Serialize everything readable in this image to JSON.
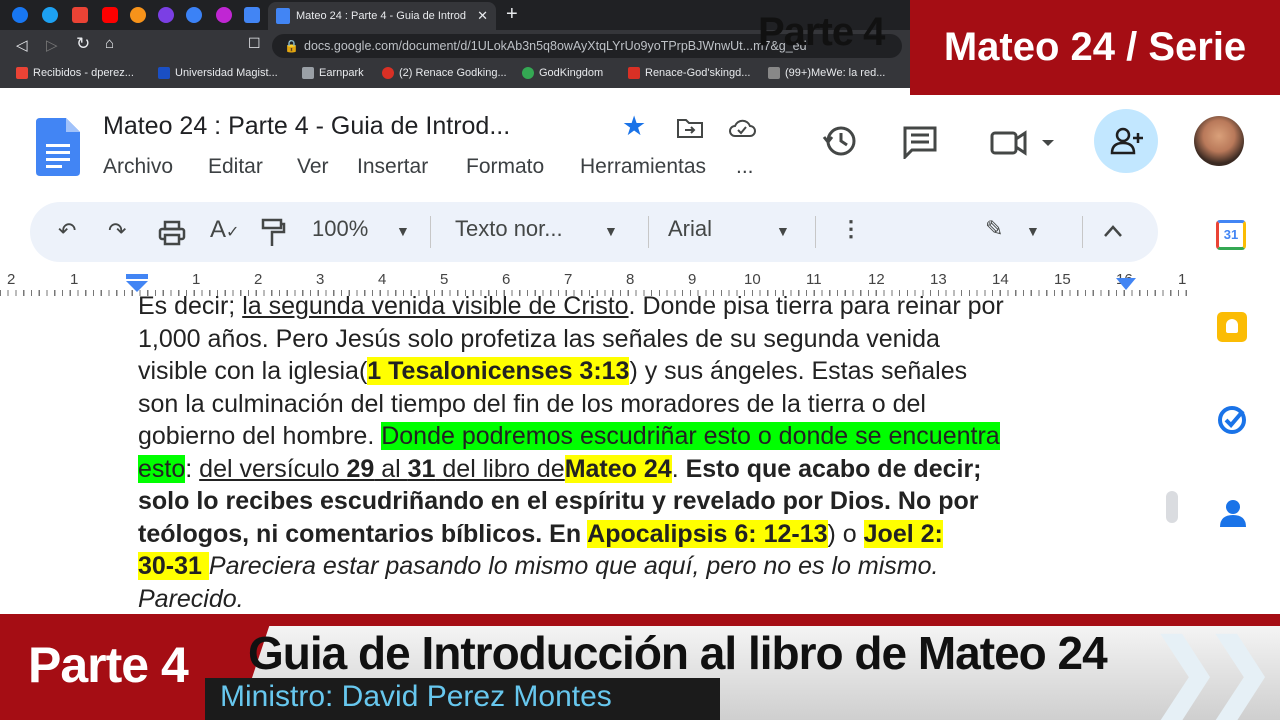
{
  "browser": {
    "active_tab_title": "Mateo 24 : Parte 4 - Guia de Introd",
    "url": "docs.google.com/document/d/1ULokAb3n5q8owAyXtqLYrUo9yoTPrpBJWnwUt...m7&g_ed",
    "bookmarks": [
      "Recibidos - dperez...",
      "Universidad Magist...",
      "Earnpark",
      "(2) Renace Godking...",
      "GodKingdom",
      "Renace-God'skingd...",
      "(99+)MeWe: la red..."
    ]
  },
  "overlay": {
    "serie_banner": "Mateo 24 / Serie",
    "parte_text": "Parte 4"
  },
  "docs": {
    "title": "Mateo 24 : Parte 4 -  Guia de Introd...",
    "menu": [
      "Archivo",
      "Editar",
      "Ver",
      "Insertar",
      "Formato",
      "Herramientas",
      "..."
    ],
    "toolbar": {
      "zoom": "100%",
      "style": "Texto nor...",
      "font": "Arial"
    },
    "ruler_numbers": [
      "2",
      "1",
      "1",
      "2",
      "3",
      "4",
      "5",
      "6",
      "7",
      "8",
      "9",
      "10",
      "11",
      "12",
      "13",
      "14",
      "15",
      "16",
      "1"
    ],
    "calendar_day": "31"
  },
  "content": {
    "l1a": "Es decir; ",
    "l1u": "la segunda venida visible de Cristo",
    "l1b": ". Donde pisa tierra para reinar por",
    "l2": "1,000 años. Pero Jesús solo profetiza las señales de su segunda venida",
    "l3a": "visible con la iglesia(",
    "l3ref": "1 Tesalonicenses 3:13",
    "l3b": ") y sus ángeles. Estas señales",
    "l4": "son la culminación del tiempo del fin de los moradores de la tierra o del",
    "l5a": "gobierno del hombre. ",
    "l5g": "Donde podremos escudriñar esto o donde se encuentra",
    "l6g": "esto",
    "l6a": ": ",
    "l6u1": "del versículo ",
    "l6n1": "29",
    "l6u2": " al ",
    "l6n2": "31",
    "l6u3": " del libro de",
    "l6ref": "Mateo 24",
    "l6b": ". ",
    "l6bold": "Esto que acabo de decir;",
    "l7": "solo lo recibes escudriñando en el espíritu y revelado por Dios. No por",
    "l8a": "teólogos, ni comentarios bíblicos. En ",
    "l8ref": "Apocalipsis 6: 12-13",
    "l8b": ") o ",
    "l8ref2": "Joel 2:",
    "l9ref": "30-31 ",
    "l9i": "Pareciera estar pasando lo mismo que aquí, pero no es lo mismo.",
    "l10i": "Parecido."
  },
  "lower_third": {
    "parte": "Parte 4",
    "title": "Guia de Introducción al libro de Mateo 24",
    "minister": "Ministro: David Perez Montes"
  },
  "colors": {
    "banner_red": "#a50d14",
    "highlight_yellow": "#ffff00",
    "highlight_green": "#00ff00",
    "docs_blue": "#4285f4"
  }
}
